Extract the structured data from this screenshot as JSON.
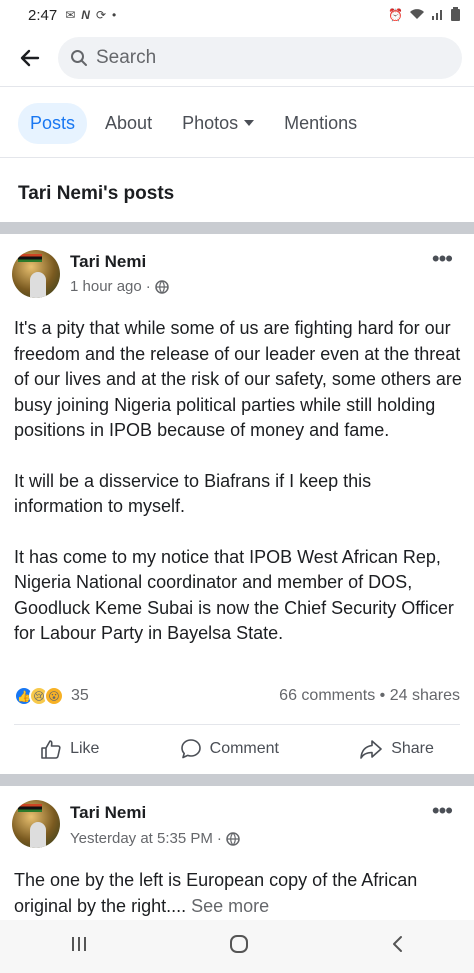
{
  "status_bar": {
    "time": "2:47"
  },
  "search": {
    "placeholder": "Search"
  },
  "tabs": [
    {
      "label": "Posts",
      "active": true
    },
    {
      "label": "About"
    },
    {
      "label": "Photos",
      "has_dropdown": true
    },
    {
      "label": "Mentions"
    }
  ],
  "section_title": "Tari Nemi's posts",
  "posts": [
    {
      "author": "Tari Nemi",
      "time": "1 hour ago",
      "paragraphs": [
        "It's a pity that while some of us are fighting hard for our freedom and the release of our leader even at the threat of our lives and at the risk of our safety, some others are busy joining Nigeria political parties while still holding positions in IPOB because of money and fame.",
        "It will be a disservice to Biafrans if I keep this information to myself.",
        "It has come to my notice that IPOB West African Rep, Nigeria National coordinator and member of DOS, Goodluck Keme Subai is now the Chief Security Officer for Labour Party in Bayelsa State."
      ],
      "reaction_count": "35",
      "comments": "66 comments",
      "shares": "24 shares",
      "stats_separator": "•"
    },
    {
      "author": "Tari Nemi",
      "time": "Yesterday at 5:35 PM",
      "text": "The one by the left is European copy of the African original by the right....",
      "see_more": "See more"
    }
  ],
  "actions": {
    "like": "Like",
    "comment": "Comment",
    "share": "Share"
  },
  "icons": [
    "back-arrow-icon",
    "search-icon",
    "globe-icon",
    "more-icon",
    "like-icon",
    "comment-icon",
    "share-icon",
    "recents-icon",
    "home-icon",
    "back-icon"
  ],
  "colors": {
    "accent": "#1877f2",
    "active_tab_bg": "#e7f3ff",
    "separator": "#c9ccd1"
  }
}
